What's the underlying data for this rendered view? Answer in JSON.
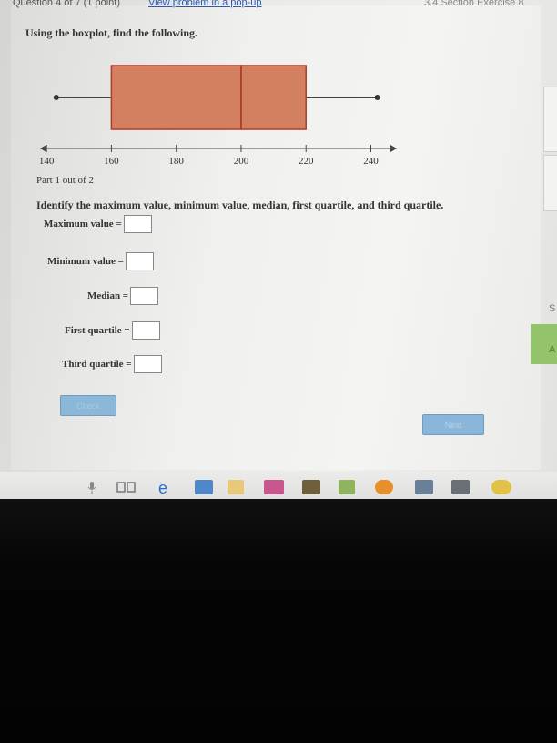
{
  "header": {
    "question_label": "Question 4 of 7 (1 point)",
    "popup_link": "View problem in a pop-up",
    "section_title": "3.4 Section Exercise 8"
  },
  "instruction": "Using the boxplot, find the following.",
  "chart_data": {
    "type": "boxplot",
    "min": 143,
    "q1": 160,
    "median": 200,
    "q3": 220,
    "max": 242,
    "axis_ticks": [
      140,
      160,
      180,
      200,
      220,
      240
    ],
    "xlim": [
      138,
      248
    ],
    "box_color": "#d2805f",
    "box_edge": "#b03a2a"
  },
  "part_label": "Part 1 out of 2",
  "question": "Identify the maximum value, minimum value, median, first quartile, and third quartile.",
  "fields": [
    {
      "label": "Maximum value =",
      "value": ""
    },
    {
      "label": "Minimum value =",
      "value": ""
    },
    {
      "label": "Median =",
      "value": ""
    },
    {
      "label": "First quartile =",
      "value": ""
    },
    {
      "label": "Third quartile =",
      "value": ""
    }
  ],
  "buttons": {
    "check": "Check",
    "next": "Next"
  },
  "side_panel": {
    "letters": [
      "S",
      "A"
    ]
  }
}
